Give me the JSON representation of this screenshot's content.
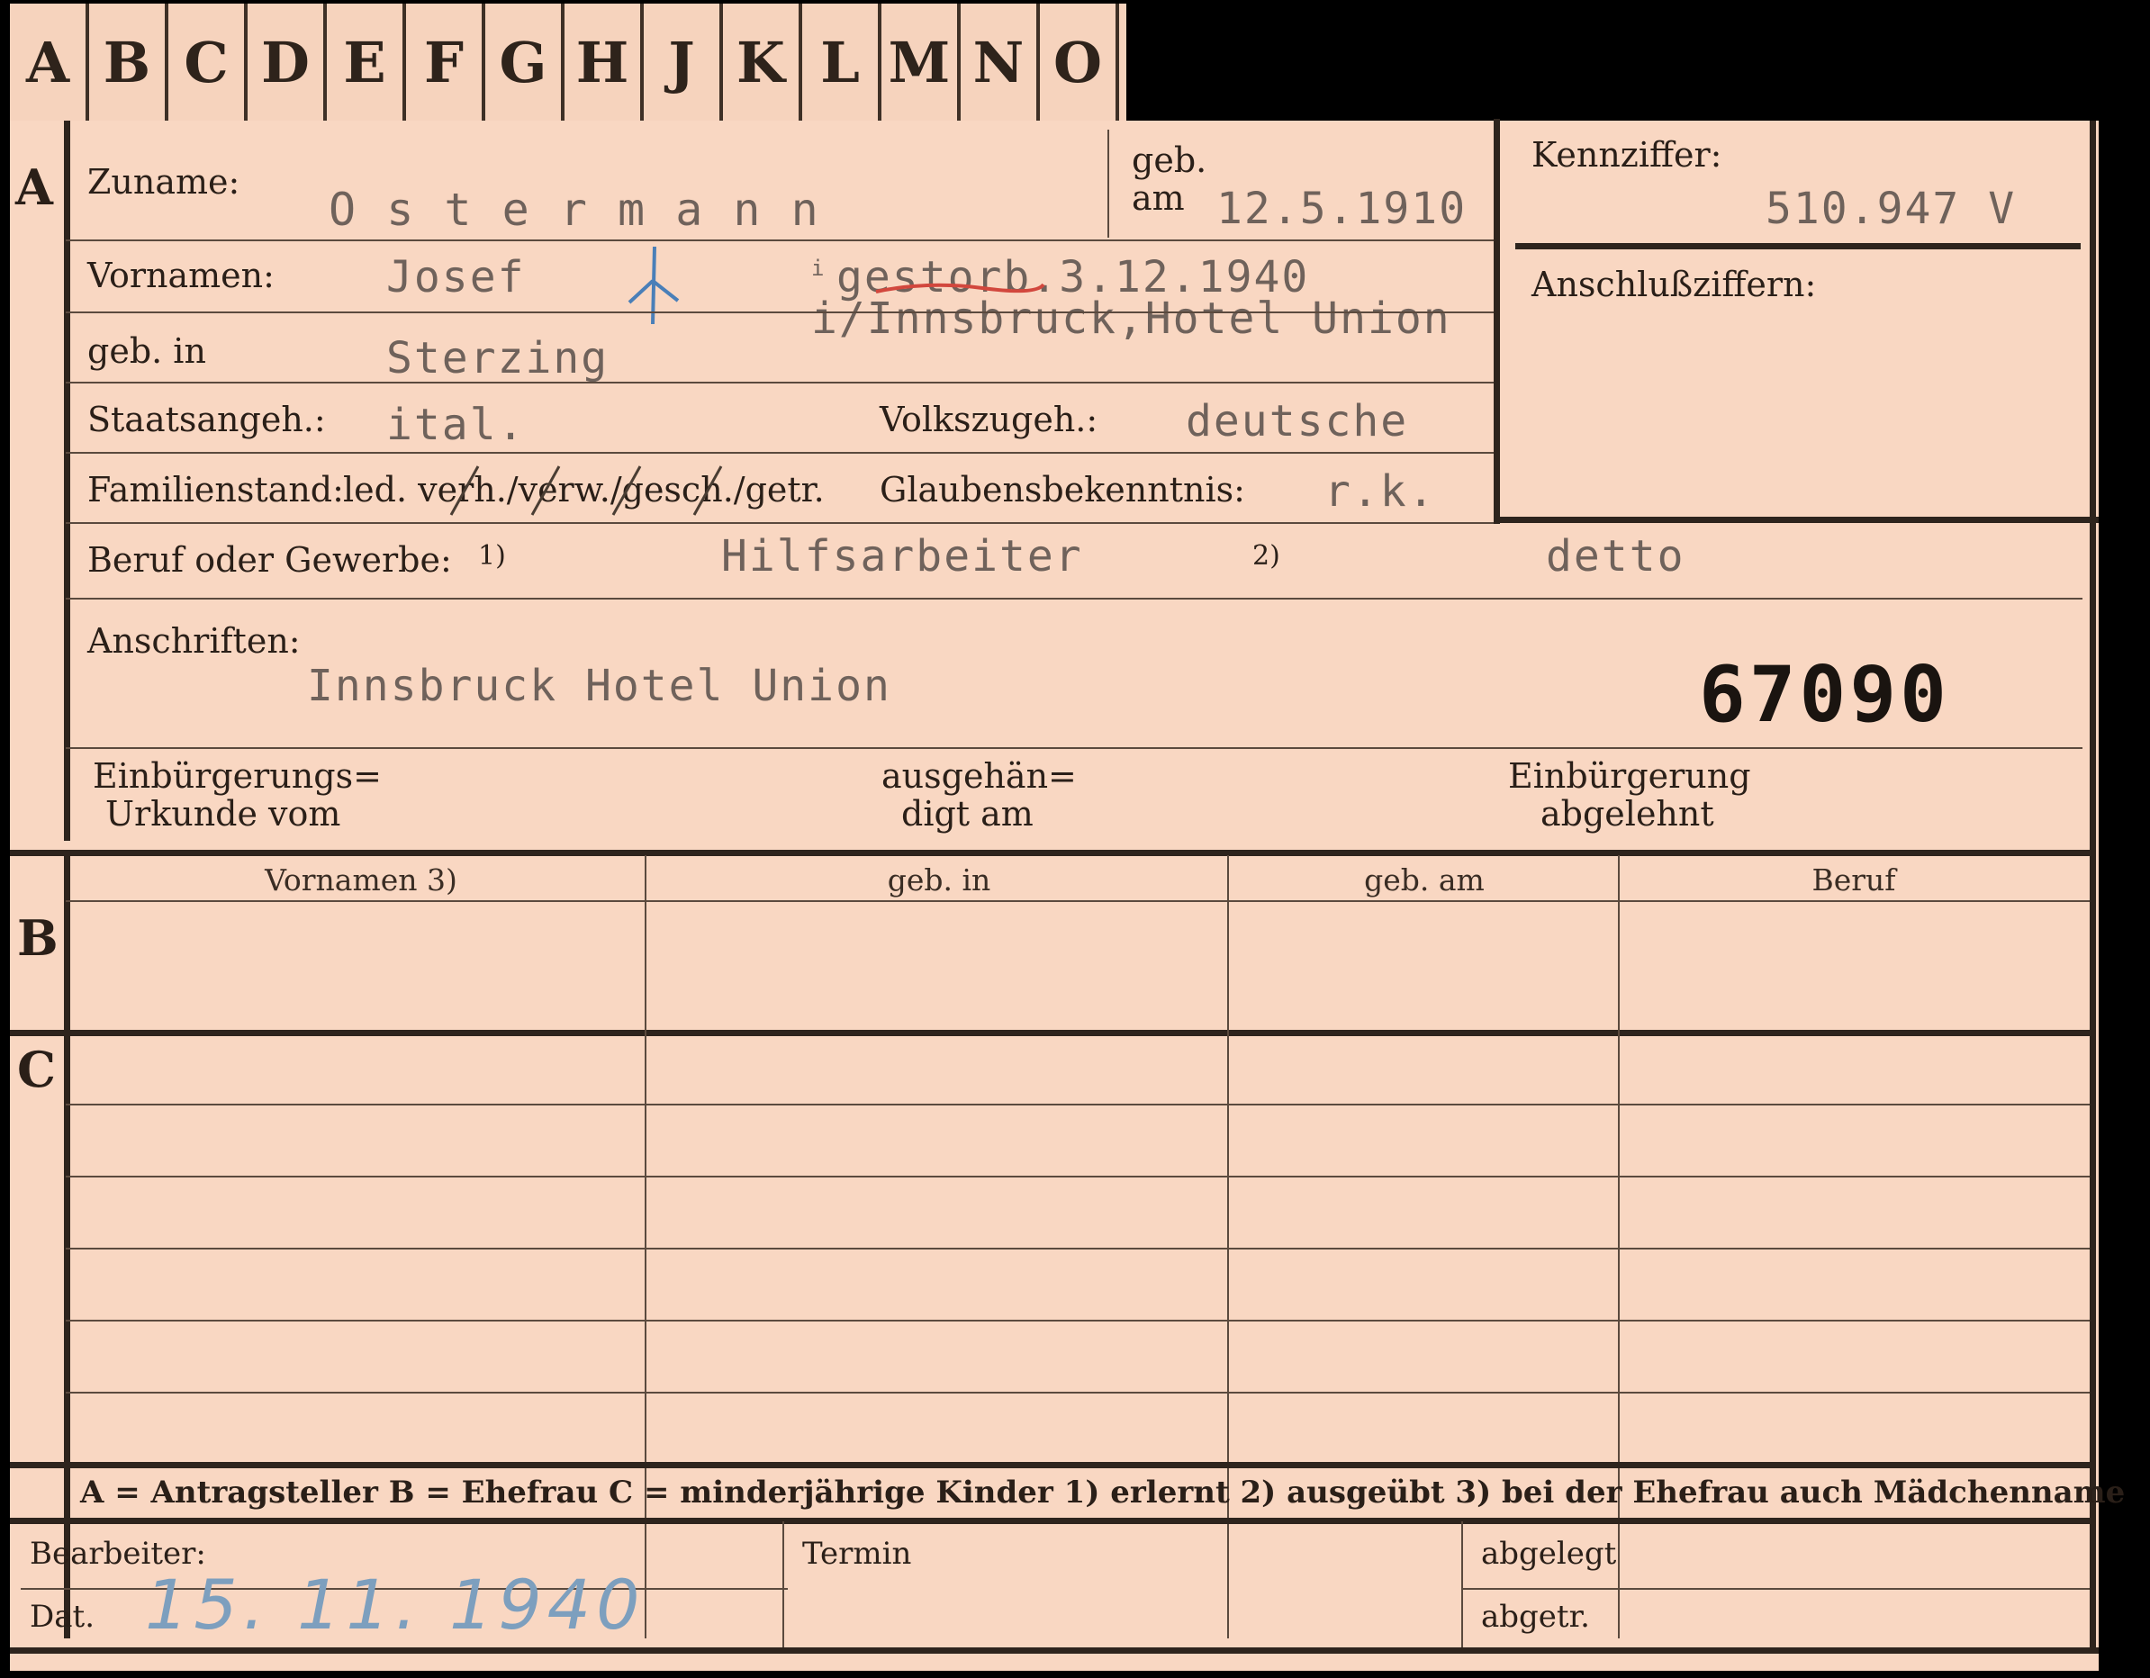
{
  "tabs": [
    "A",
    "B",
    "C",
    "D",
    "E",
    "F",
    "G",
    "H",
    "J",
    "K",
    "L",
    "M",
    "N",
    "O"
  ],
  "section_letters": {
    "a": "A",
    "b": "B",
    "c": "C"
  },
  "labels": {
    "zuname": "Zuname:",
    "geb": "geb.",
    "am": "am",
    "vornamen": "Vornamen:",
    "geb_in": "geb. in",
    "staatsangeh": "Staatsangeh.:",
    "volkszugeh": "Volkszugeh.:",
    "familienstand": "Familienstand:",
    "familienstand_options": "led. verh./verw./gesch./getr.",
    "glaubensbekenntnis": "Glaubensbekenntnis:",
    "beruf": "Beruf oder Gewerbe:",
    "fn1": "1)",
    "fn2": "2)",
    "anschriften": "Anschriften:",
    "einb_urkunde_1": "Einbürgerungs=",
    "einb_urkunde_2": "Urkunde vom",
    "ausgehaendigt_1": "ausgehän=",
    "ausgehaendigt_2": "digt am",
    "einb_abgelehnt_1": "Einbürgerung",
    "einb_abgelehnt_2": "abgelehnt",
    "kennziffer": "Kennziffer:",
    "anschlussziffern": "Anschlußziffern:"
  },
  "values": {
    "zuname": "O s t e r m a n n",
    "geb_am": "12.5.1910",
    "vornamen": "Josef",
    "gestorben": "gestorb.3.12.1940",
    "gestorben_ort": "i/Innsbruck,Hotel Union",
    "gestorben_prefix": "i",
    "geb_in": "Sterzing",
    "staatsangeh": "ital.",
    "volkszugeh": "deutsche",
    "glaubensbekenntnis": "r.k.",
    "beruf_erlernt": "Hilfsarbeiter",
    "beruf_ausgeuebt": "detto",
    "anschrift": "Innsbruck Hotel Union",
    "aktennummer": "67090",
    "kennziffer": "510.947  V"
  },
  "table_b": {
    "headers": [
      "Vornamen 3)",
      "geb. in",
      "geb. am",
      "Beruf"
    ]
  },
  "legend": "A = Antragsteller   B = Ehefrau   C = minderjährige Kinder   1) erlernt   2) ausgeübt   3) bei der Ehefrau auch Mädchenname",
  "footer": {
    "bearbeiter": "Bearbeiter:",
    "dat": "Dat.",
    "dat_value": "15. 11. 1940",
    "termin": "Termin",
    "abgelegt": "abgelegt",
    "abgetr": "abgetr."
  },
  "colors": {
    "card": "#f9d7c2",
    "ink": "#2a1f18",
    "typewriter": "#6f625b",
    "stamp": "#7d9fbe",
    "red_underline": "#d2473d",
    "blue_mark": "#4a7fb8"
  }
}
